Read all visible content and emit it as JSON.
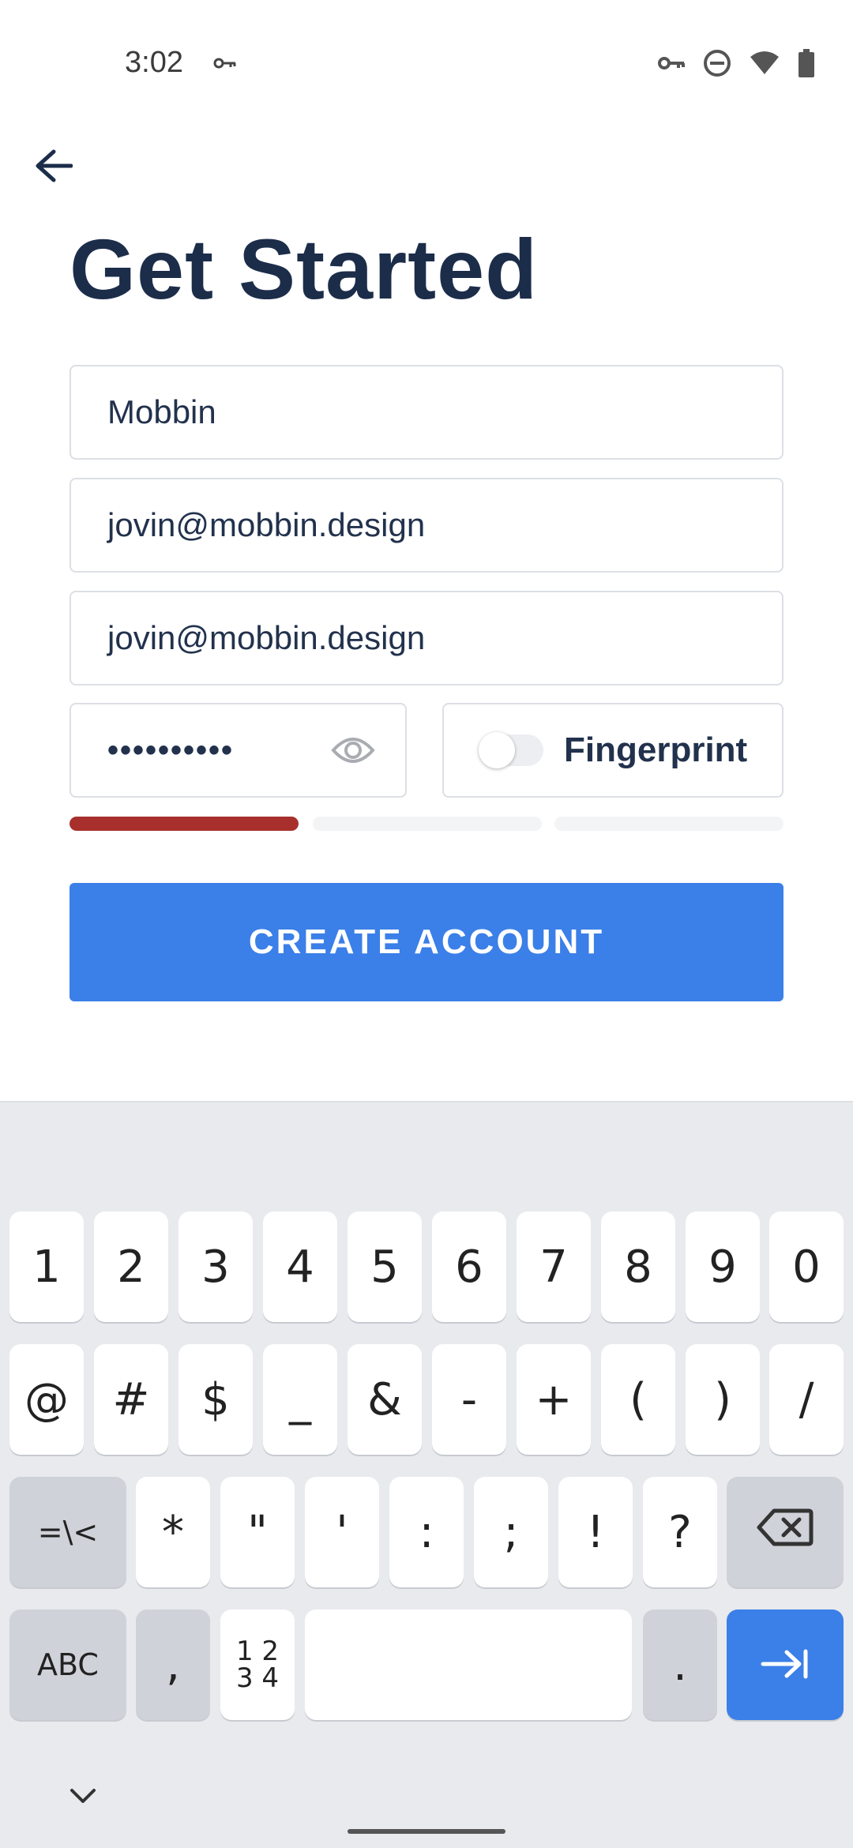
{
  "status_bar": {
    "time": "3:02"
  },
  "title": "Get Started",
  "fields": {
    "name": "Mobbin",
    "email": "jovin@mobbin.design",
    "confirm_email": "jovin@mobbin.design",
    "password_masked": "••••••••••"
  },
  "fingerprint": {
    "label": "Fingerprint",
    "enabled": false
  },
  "password_strength": {
    "level": 1,
    "of": 3,
    "color": "#a8302c"
  },
  "create_button": {
    "label": "CREATE ACCOUNT",
    "color": "#3b7fe8"
  },
  "keyboard": {
    "row1": [
      "1",
      "2",
      "3",
      "4",
      "5",
      "6",
      "7",
      "8",
      "9",
      "0"
    ],
    "row2": [
      "@",
      "#",
      "$",
      "_",
      "&",
      "-",
      "+",
      "(",
      ")",
      "/"
    ],
    "row3": {
      "left": "=\\<",
      "keys": [
        "*",
        "\"",
        "'",
        ":",
        ";",
        "!",
        "?"
      ]
    },
    "row4": {
      "abc": "ABC",
      "comma": ",",
      "numpad_top": "1 2",
      "numpad_bottom": "3 4",
      "period": "."
    }
  }
}
